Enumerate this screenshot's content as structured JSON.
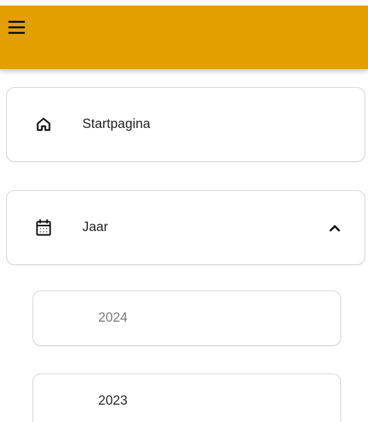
{
  "app": {
    "header_color": "#e39e00"
  },
  "header": {
    "menu_icon": "hamburger-menu-icon"
  },
  "navigation": {
    "home": {
      "icon": "home-icon",
      "label": "Startpagina"
    },
    "year": {
      "icon": "calendar-icon",
      "label": "Jaar",
      "expanded": true,
      "chevron_icon": "chevron-up-icon",
      "options": [
        {
          "label": "2024",
          "muted": true
        },
        {
          "label": "2023",
          "muted": false
        }
      ]
    }
  }
}
